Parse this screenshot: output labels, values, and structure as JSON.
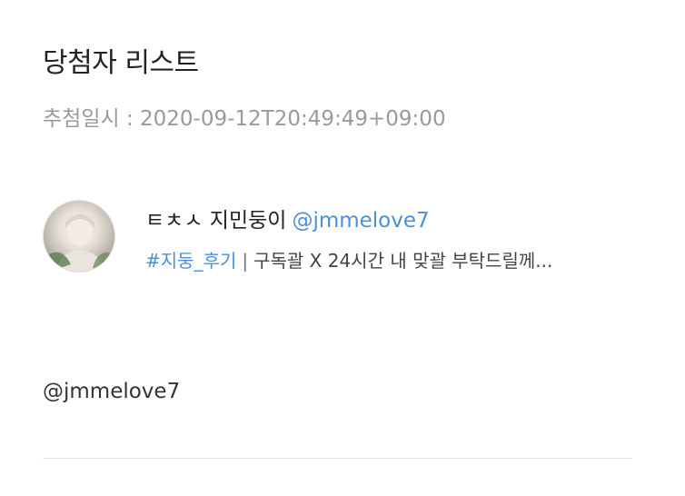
{
  "header": {
    "title": "당첨자 리스트",
    "draw_date": "추첨일시 : 2020-09-12T20:49:49+09:00"
  },
  "winner_card": {
    "avatar_icon": "profile-photo",
    "display_name": "ㅌㅊㅅ 지민둥이",
    "handle": "@jmmelove7",
    "hashtag": "#지둥_후기",
    "separator": "|",
    "post_excerpt": "구독괄 X 24시간 내 맞괄 부탁드릴께..."
  },
  "winners": [
    {
      "handle": "@jmmelove7"
    }
  ],
  "colors": {
    "link": "#4a90d9",
    "muted": "#9a9a9a",
    "text": "#222222",
    "divider": "#e6e6e6"
  }
}
